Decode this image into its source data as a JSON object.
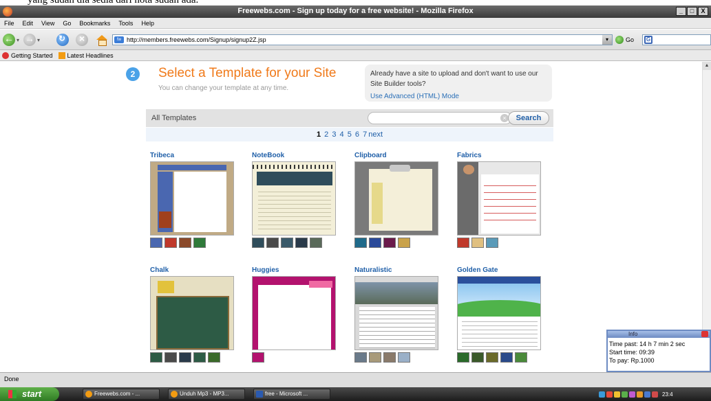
{
  "crop_text": "yang sudah dia sedia dari nota sudah ada.",
  "window": {
    "title": "Freewebs.com - Sign up today for a free website! - Mozilla Firefox",
    "buttons": [
      "_",
      "□",
      "X"
    ]
  },
  "menu": [
    "File",
    "Edit",
    "View",
    "Go",
    "Bookmarks",
    "Tools",
    "Help"
  ],
  "nav": {
    "url": "http://members.freewebs.com/Signup/signup2Z.jsp",
    "favicon_text": "fw",
    "go_label": "Go"
  },
  "bookmarks": [
    "Getting Started",
    "Latest Headlines"
  ],
  "page": {
    "step_number": "2",
    "title": "Select a Template for your Site",
    "subtitle": "You can change your template at any time.",
    "advanced_text": "Already have a site to upload and don't want to use our Site Builder tools?",
    "advanced_link": "Use Advanced (HTML) Mode",
    "filter_label": "All Templates",
    "search_label": "Search",
    "pages": [
      "1",
      "2",
      "3",
      "4",
      "5",
      "6",
      "7"
    ],
    "next_label": "next",
    "templates": [
      {
        "name": "Tribeca",
        "swatches": [
          "#4a67b0",
          "#c0392b",
          "#8b4a2a",
          "#2f7a3a"
        ]
      },
      {
        "name": "NoteBook",
        "swatches": [
          "#2f4d5b",
          "#4a4a4a",
          "#3a5a6a",
          "#2a3a4a",
          "#5a6a5a"
        ]
      },
      {
        "name": "Clipboard",
        "swatches": [
          "#1f6a8a",
          "#2a4a9a",
          "#6a1a4a",
          "#c9a24a"
        ]
      },
      {
        "name": "Fabrics",
        "swatches": [
          "#c0392b",
          "#e0c080",
          "#5a9ab8"
        ]
      },
      {
        "name": "Chalk",
        "swatches": [
          "#2d5b45",
          "#4a4a4a",
          "#2a3a4a",
          "#2d5b45",
          "#3a6a2a"
        ]
      },
      {
        "name": "Huggies",
        "swatches": [
          "#b3126e"
        ]
      },
      {
        "name": "Naturalistic",
        "swatches": [
          "#6a7a8a",
          "#a89a7a",
          "#8a7a6a",
          "#9ab0c8"
        ]
      },
      {
        "name": "Golden Gate",
        "swatches": [
          "#2a6a2a",
          "#3a5a2a",
          "#6a6a2a",
          "#2a4a8a",
          "#4a8a3a"
        ]
      }
    ]
  },
  "info": {
    "title": "Info",
    "time_past": "Time past: 14 h 7 min 2 sec",
    "start_time": "Start time: 09:39",
    "to_pay": "To pay: Rp.1000"
  },
  "status": "Done",
  "taskbar": {
    "start": "start",
    "tasks": [
      "Freewebs.com - ...",
      "Unduh Mp3 - MP3...",
      "free - Microsoft ..."
    ],
    "clock": "23:4"
  }
}
